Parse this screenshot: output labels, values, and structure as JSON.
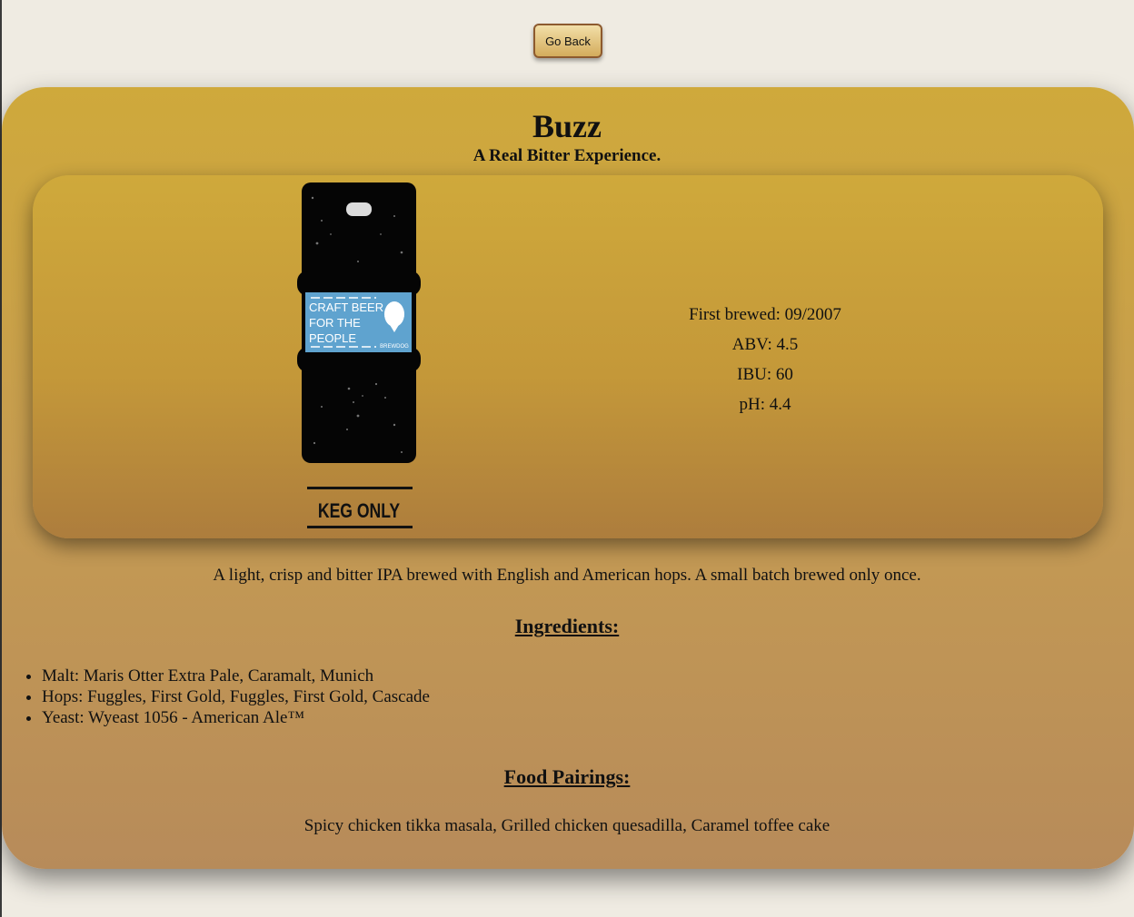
{
  "nav": {
    "go_back_label": "Go Back"
  },
  "beer": {
    "name": "Buzz",
    "tagline": "A Real Bitter Experience.",
    "image": {
      "label_line1": "CRAFT BEER",
      "label_line2": "FOR THE",
      "label_line3": "PEOPLE",
      "brand": "BREWDOG",
      "keg_text": "KEG ONLY"
    },
    "stats": {
      "first_brewed": "First brewed: 09/2007",
      "abv": "ABV: 4.5",
      "ibu": "IBU: 60",
      "ph": "pH: 4.4"
    },
    "description": "A light, crisp and bitter IPA brewed with English and American hops. A small batch brewed only once.",
    "ingredients_heading": "Ingredients:",
    "ingredients": [
      "Malt: Maris Otter Extra Pale, Caramalt, Munich",
      "Hops: Fuggles, First Gold, Fuggles, First Gold, Cascade",
      "Yeast: Wyeast 1056 - American Ale™"
    ],
    "food_heading": "Food Pairings:",
    "food_pairings": "Spicy chicken tikka masala, Grilled chicken quesadilla, Caramel toffee cake"
  },
  "colors": {
    "page_background": "#efebe2",
    "card_top": "#cfa93b",
    "card_bottom": "#b78b5a",
    "label_blue": "#5fa3cf",
    "keg_black": "#050505"
  }
}
